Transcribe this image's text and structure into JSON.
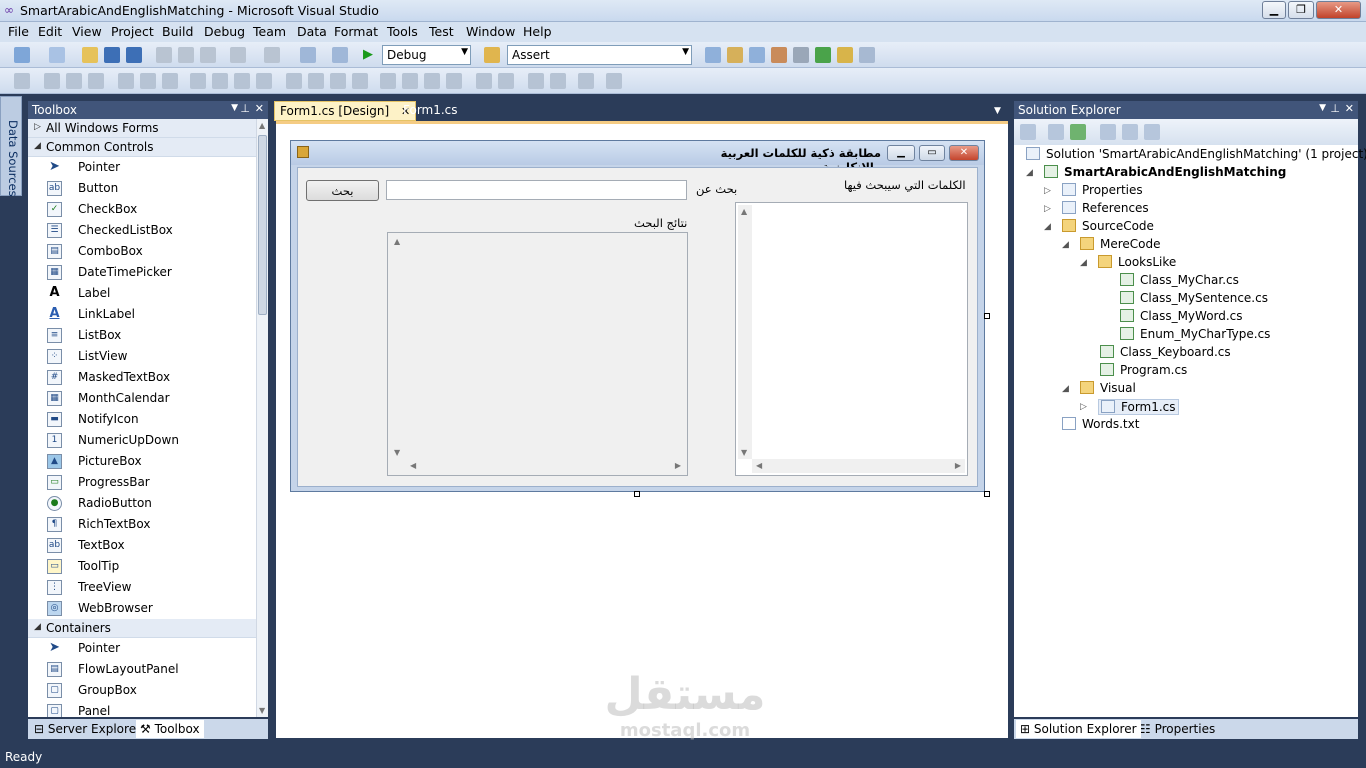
{
  "window": {
    "title": "SmartArabicAndEnglishMatching - Microsoft Visual Studio"
  },
  "menu": [
    "File",
    "Edit",
    "View",
    "Project",
    "Build",
    "Debug",
    "Team",
    "Data",
    "Format",
    "Tools",
    "Test",
    "Window",
    "Help"
  ],
  "toolbar": {
    "config": "Debug",
    "find": "Assert"
  },
  "datasources": {
    "label": "Data Sources"
  },
  "toolbox": {
    "title": "Toolbox",
    "categories": {
      "all": "All Windows Forms",
      "common": "Common Controls",
      "containers": "Containers"
    },
    "common": [
      "Pointer",
      "Button",
      "CheckBox",
      "CheckedListBox",
      "ComboBox",
      "DateTimePicker",
      "Label",
      "LinkLabel",
      "ListBox",
      "ListView",
      "MaskedTextBox",
      "MonthCalendar",
      "NotifyIcon",
      "NumericUpDown",
      "PictureBox",
      "ProgressBar",
      "RadioButton",
      "RichTextBox",
      "TextBox",
      "ToolTip",
      "TreeView",
      "WebBrowser"
    ],
    "containers": [
      "Pointer",
      "FlowLayoutPanel",
      "GroupBox",
      "Panel"
    ],
    "bottom_tabs": {
      "server": "Server Explorer",
      "toolbox": "Toolbox"
    }
  },
  "doc_tabs": {
    "design": "Form1.cs [Design]",
    "code": "Form1.cs"
  },
  "form": {
    "title": "مطابقة ذكية للكلمات العربية والإنكليزية",
    "search_button": "بحث",
    "search_label": "بحث عن",
    "words_label": "الكلمات التي سيبحث فيها",
    "results_label": "نتائج البحث"
  },
  "solution": {
    "title": "Solution Explorer",
    "root": "Solution 'SmartArabicAndEnglishMatching' (1 project)",
    "project": "SmartArabicAndEnglishMatching",
    "properties": "Properties",
    "references": "References",
    "sourcecode": "SourceCode",
    "merecode": "MereCode",
    "lookslike": "LooksLike",
    "f1": "Class_MyChar.cs",
    "f2": "Class_MySentence.cs",
    "f3": "Class_MyWord.cs",
    "f4": "Enum_MyCharType.cs",
    "f5": "Class_Keyboard.cs",
    "f6": "Program.cs",
    "visual": "Visual",
    "f7": "Form1.cs",
    "f8": "Words.txt",
    "bottom_tabs": {
      "solution": "Solution Explorer",
      "properties": "Properties"
    }
  },
  "status": "Ready",
  "watermark": {
    "arabic": "مستقل",
    "latin": "mostaql.com"
  }
}
